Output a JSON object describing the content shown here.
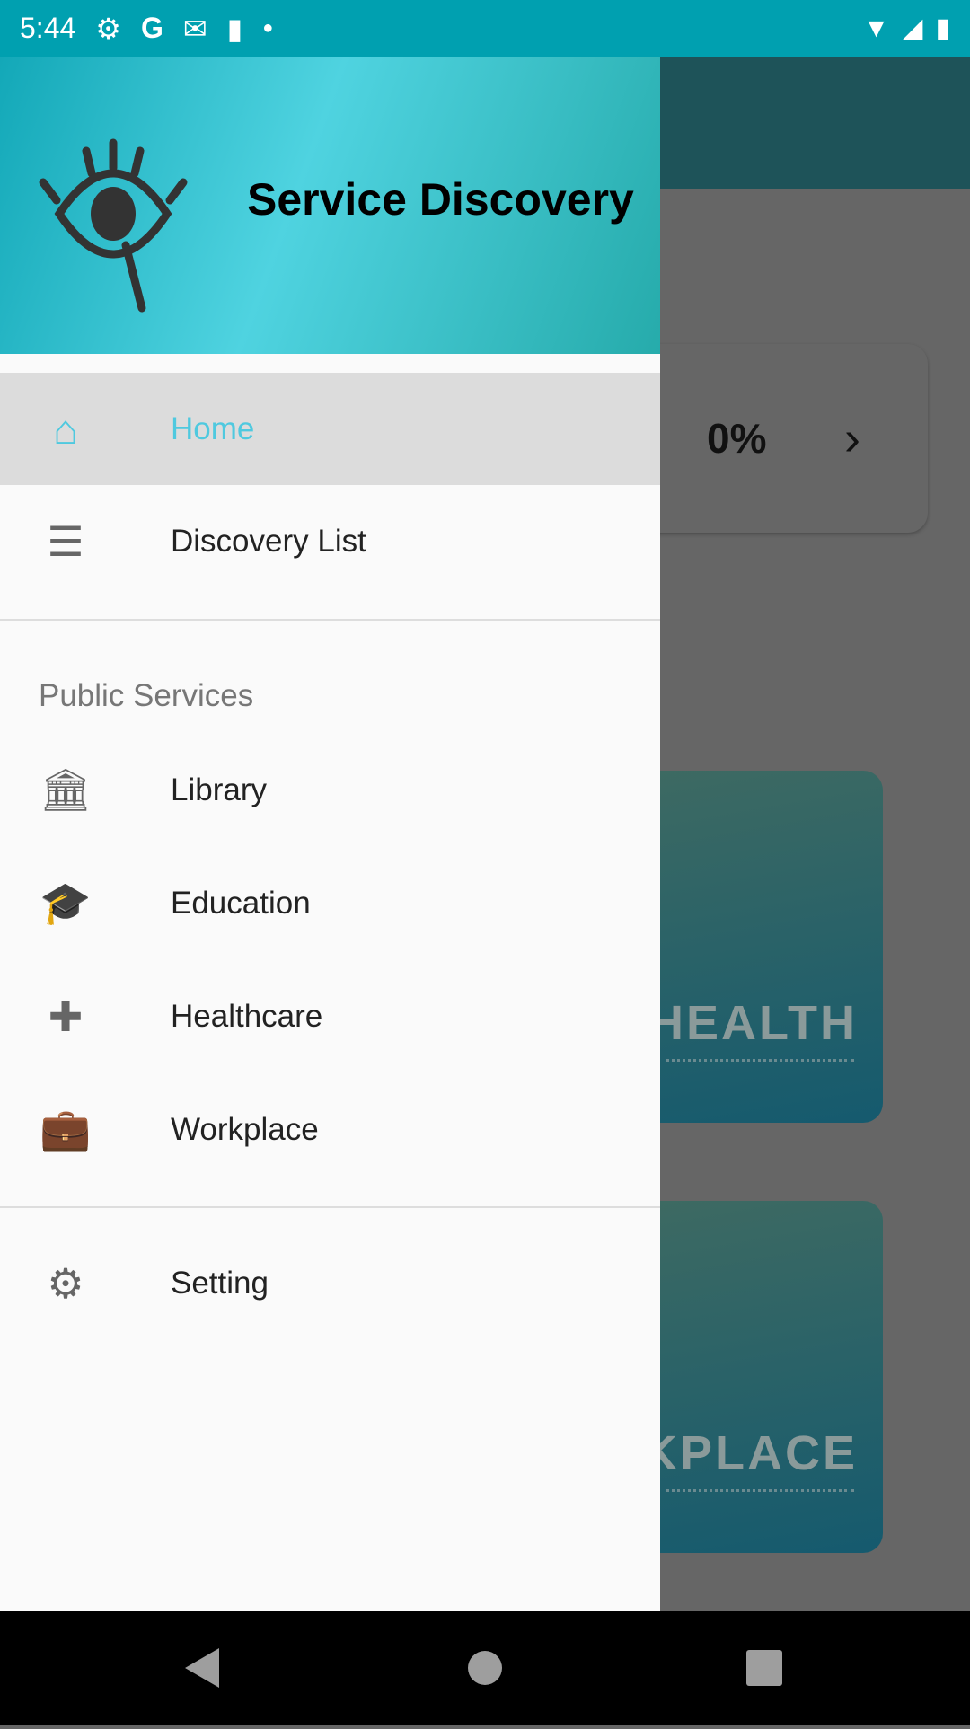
{
  "status_bar": {
    "time": "5:44",
    "icons": [
      "gear-icon",
      "google-icon",
      "gmail-icon",
      "sd-card-icon",
      "dot-icon",
      "wifi-icon",
      "signal-icon",
      "battery-icon"
    ]
  },
  "drawer": {
    "title": "Service Discovery",
    "items": [
      {
        "label": "Home",
        "icon": "home-icon",
        "selected": true
      },
      {
        "label": "Discovery List",
        "icon": "list-icon"
      }
    ],
    "section_header": "Public Services",
    "services": [
      {
        "label": "Library",
        "icon": "library-icon"
      },
      {
        "label": "Education",
        "icon": "graduation-cap-icon"
      },
      {
        "label": "Healthcare",
        "icon": "hospital-icon"
      },
      {
        "label": "Workplace",
        "icon": "work-search-icon"
      }
    ],
    "setting": {
      "label": "Setting",
      "icon": "settings-icon"
    }
  },
  "background": {
    "progress": "0%",
    "tiles": [
      "HEALTH",
      "RKPLACE"
    ]
  },
  "colors": {
    "status_bar": "#00a0b0",
    "accent": "#4fc9df",
    "app_bar": "#1e5359"
  }
}
